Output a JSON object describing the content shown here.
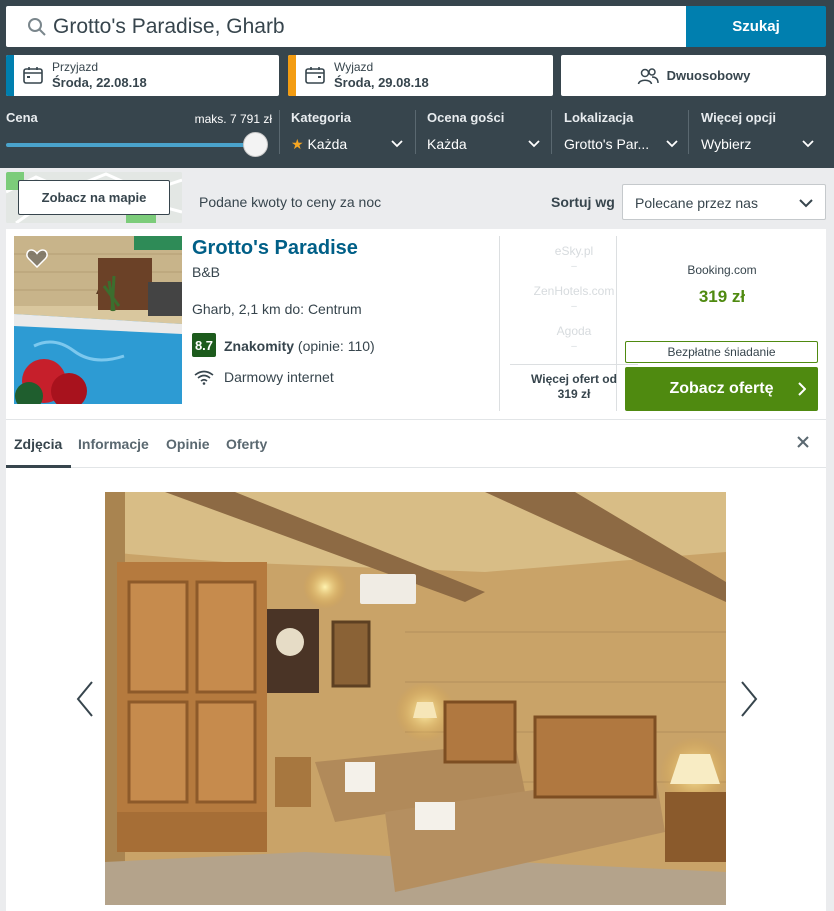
{
  "search": {
    "query": "Grotto's Paradise, Gharb",
    "button_label": "Szukaj"
  },
  "dates": {
    "checkin_label": "Przyjazd",
    "checkin_value": "Środa, 22.08.18",
    "checkout_label": "Wyjazd",
    "checkout_value": "Środa, 29.08.18"
  },
  "room": {
    "label": "Dwuosobowy"
  },
  "filters": {
    "price_title": "Cena",
    "price_max": "maks. 7 791 zł",
    "price_slider_fraction": 1.0,
    "category_title": "Kategoria",
    "category_value": "Każda",
    "rating_title": "Ocena gości",
    "rating_value": "Każda",
    "location_title": "Lokalizacja",
    "location_value": "Grotto's Par...",
    "more_title": "Więcej opcji",
    "more_value": "Wybierz"
  },
  "toolbar": {
    "map_button": "Zobacz na mapie",
    "price_note": "Podane kwoty to ceny za noc",
    "sort_label": "Sortuj wg",
    "sort_value": "Polecane przez nas"
  },
  "hotel": {
    "name": "Grotto's Paradise",
    "type": "B&B",
    "location": "Gharb, 2,1 km do: Centrum",
    "rating_score": "8.7",
    "rating_word": "Znakomity",
    "rating_count": "(opinie: 110)",
    "amenity": "Darmowy internet",
    "other_deals": [
      {
        "provider": "eSky.pl",
        "price": "–"
      },
      {
        "provider": "ZenHotels.com",
        "price": "–"
      },
      {
        "provider": "Agoda",
        "price": "–"
      }
    ],
    "more_offers_line1": "Więcej ofert od",
    "more_offers_line2": "319 zł",
    "best_provider": "Booking.com",
    "best_price": "319 zł",
    "breakfast_badge": "Bezpłatne śniadanie",
    "deal_button": "Zobacz ofertę"
  },
  "tabs": [
    {
      "label": "Zdjęcia"
    },
    {
      "label": "Informacje"
    },
    {
      "label": "Opinie"
    },
    {
      "label": "Oferty"
    }
  ],
  "colors": {
    "header_bg": "#37454d",
    "primary_blue": "#007faf",
    "deal_green": "#4f8a10",
    "rating_green": "#1d5b1d",
    "hotel_name": "#005f87",
    "checkin_accent": "#007faf",
    "checkout_accent": "#f39c12"
  }
}
